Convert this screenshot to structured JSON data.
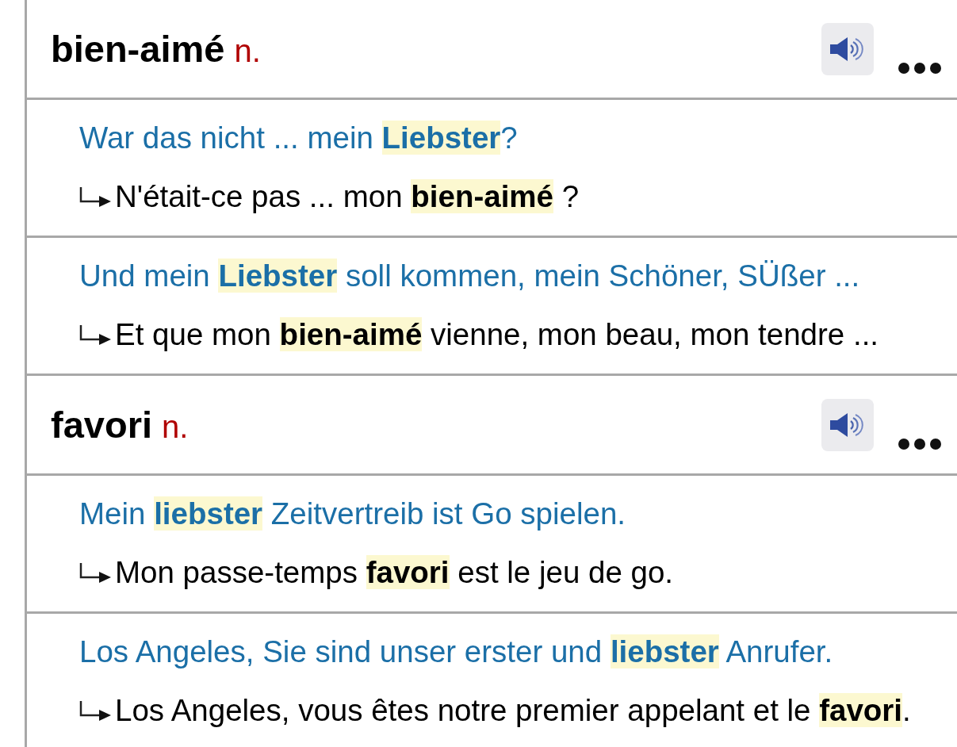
{
  "entries": [
    {
      "headword": "bien-aimé",
      "pos": "n.",
      "examples": [
        {
          "source": "War das nicht ... mein **Liebster**?",
          "translation": "N'était-ce pas ... mon **bien-aimé** ?"
        },
        {
          "source": "Und mein **Liebster** soll kommen, mein Schöner, SÜßer ...",
          "translation": "Et que mon **bien-aimé** vienne, mon beau, mon tendre ..."
        }
      ]
    },
    {
      "headword": "favori",
      "pos": "n.",
      "examples": [
        {
          "source": "Mein **liebster** Zeitvertreib ist Go spielen.",
          "translation": "Mon passe-temps **favori** est le jeu de go."
        },
        {
          "source": "Los Angeles, Sie sind unser erster und **liebster** Anrufer.",
          "translation": "Los Angeles, vous êtes notre premier appelant et le **favori**."
        }
      ]
    }
  ]
}
